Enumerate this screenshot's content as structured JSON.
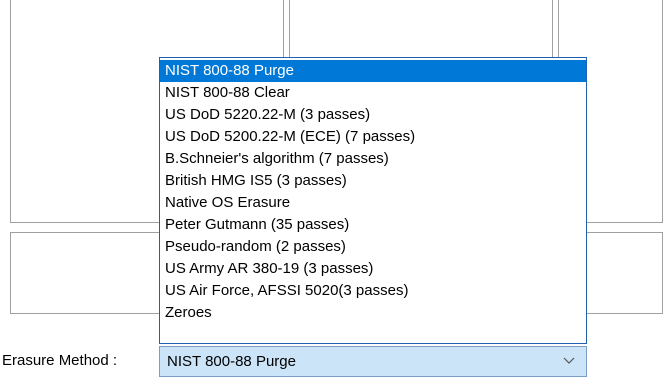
{
  "erasure": {
    "label": "Erasure Method :",
    "selected": "NIST 800-88 Purge",
    "options": [
      "NIST 800-88 Purge",
      "NIST 800-88 Clear",
      "US DoD 5220.22-M (3 passes)",
      "US DoD 5200.22-M (ECE) (7 passes)",
      "B.Schneier's algorithm (7 passes)",
      "British HMG IS5 (3 passes)",
      "Native OS Erasure",
      "Peter Gutmann (35 passes)",
      "Pseudo-random (2 passes)",
      "US Army AR 380-19 (3 passes)",
      "US Air Force, AFSSI 5020(3 passes)",
      "Zeroes"
    ]
  },
  "icons": {
    "combo_arrow": "chevron-down-icon"
  },
  "colors": {
    "selection": "#0078d7",
    "combo_background": "#cce4f7",
    "dropdown_border": "#1e5fb0"
  }
}
